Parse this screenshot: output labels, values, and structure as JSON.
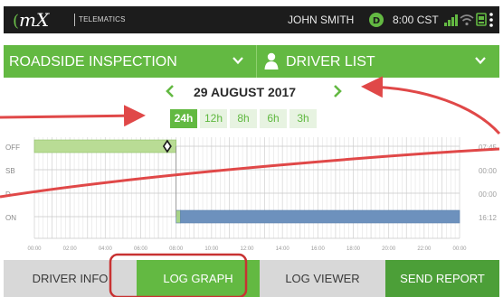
{
  "status_bar": {
    "logo_text": "mX",
    "telematics": "TELEMATICS",
    "user_name": "JOHN SMITH",
    "clock": "8:00 CST",
    "icons": [
      "driver-status-icon",
      "signal-icon",
      "wifi-icon",
      "device-icon",
      "overflow-menu-icon"
    ]
  },
  "header": {
    "inspection_label": "ROADSIDE INSPECTION",
    "driver_list_label": "DRIVER LIST",
    "icons": [
      "chevron-down-icon",
      "person-icon",
      "chevron-down-icon"
    ]
  },
  "date_nav": {
    "date": "29 AUGUST 2017",
    "icons": [
      "chevron-left-icon",
      "chevron-right-icon"
    ]
  },
  "range_tabs": [
    {
      "label": "24h",
      "active": true
    },
    {
      "label": "12h",
      "active": false
    },
    {
      "label": "8h",
      "active": false
    },
    {
      "label": "6h",
      "active": false
    },
    {
      "label": "3h",
      "active": false
    }
  ],
  "chart_data": {
    "type": "log-graph",
    "rows": [
      "OFF",
      "SB",
      "D",
      "ON"
    ],
    "x_ticks": [
      "00:00",
      "02:00",
      "04:00",
      "06:00",
      "08:00",
      "10:00",
      "12:00",
      "14:00",
      "16:00",
      "18:00",
      "20:00",
      "22:00",
      "00:00"
    ],
    "xlim": [
      0,
      24
    ],
    "segments": [
      {
        "status": "OFF",
        "start": 0,
        "end": 8
      },
      {
        "status": "ON",
        "start": 8,
        "end": 8.25
      },
      {
        "status": "ON",
        "start": 8.25,
        "end": 24
      }
    ],
    "marker": {
      "status": "OFF",
      "time": 7.5
    },
    "totals": [
      "07:45",
      "00:00",
      "00:00",
      "16:12"
    ],
    "colors": {
      "off": "#b9dc95",
      "on_start": "#a8d488",
      "on": "#6d91bd",
      "grid": "#d6d6d6"
    }
  },
  "bottom_nav": {
    "buttons": [
      "DRIVER INFO",
      "LOG GRAPH",
      "LOG VIEWER",
      "SEND REPORT"
    ]
  },
  "colors": {
    "brand_green": "#63b942",
    "dark_green": "#4c9f38",
    "annotation_red": "#e04848",
    "status_bar": "#1c1c1c"
  }
}
